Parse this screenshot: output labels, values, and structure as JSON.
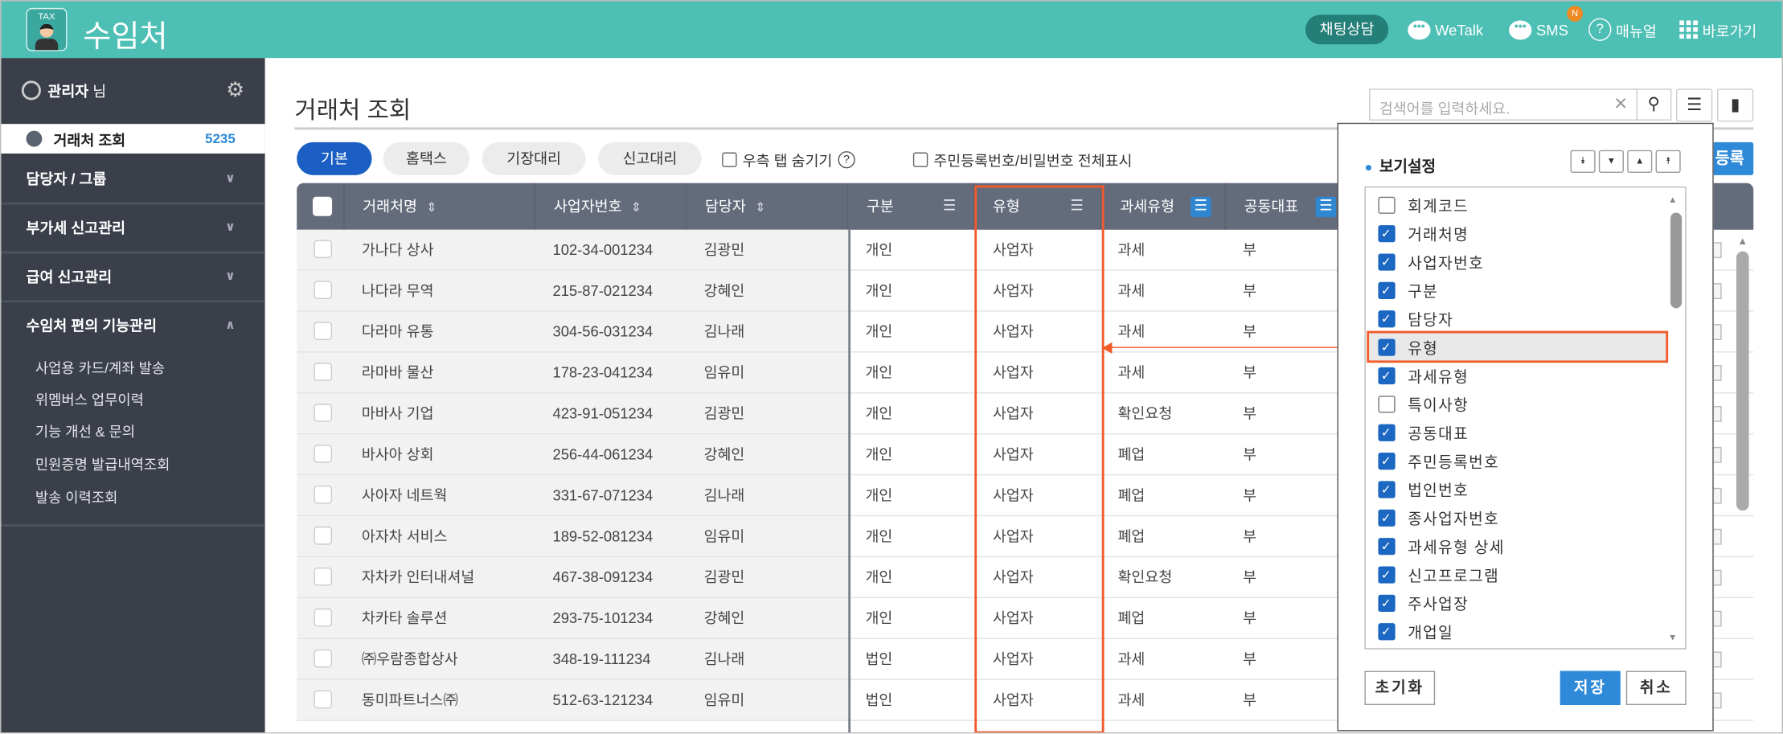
{
  "header": {
    "app_title": "수임처",
    "logo_text": "TAX",
    "chat_label": "채팅상담",
    "wetalk_label": "WeTalk",
    "sms_label": "SMS",
    "sms_badge": "N",
    "manual_label": "매뉴얼",
    "shortcut_label": "바로가기"
  },
  "sidebar": {
    "user_name": "관리자",
    "user_suffix": "님",
    "active_item": {
      "label": "거래처 조회",
      "count": "5235"
    },
    "groups": [
      {
        "label": "담당자 / 그룹"
      },
      {
        "label": "부가세 신고관리"
      },
      {
        "label": "급여 신고관리"
      },
      {
        "label": "수임처 편의 기능관리"
      }
    ],
    "sub_items": [
      "사업용 카드/계좌 발송",
      "위멤버스 업무이력",
      "기능 개선 & 문의",
      "민원증명 발급내역조회",
      "발송 이력조회"
    ]
  },
  "main": {
    "title": "거래처 조회",
    "tabs": [
      "기본",
      "홈택스",
      "기장대리",
      "신고대리"
    ],
    "hide_right_tab_label": "우측 탭 숨기기",
    "show_full_id_label": "주민등록번호/비밀번호 전체표시",
    "search_placeholder": "검색어를 입력하세요.",
    "register_label": "등록"
  },
  "table": {
    "columns": [
      "거래처명",
      "사업자번호",
      "담당자",
      "구분",
      "유형",
      "과세유형",
      "공동대표"
    ],
    "rows": [
      [
        "가나다 상사",
        "102-34-001234",
        "김광민",
        "개인",
        "사업자",
        "과세",
        "부"
      ],
      [
        "나다라 무역",
        "215-87-021234",
        "강혜인",
        "개인",
        "사업자",
        "과세",
        "부"
      ],
      [
        "다라마 유통",
        "304-56-031234",
        "김나래",
        "개인",
        "사업자",
        "과세",
        "부"
      ],
      [
        "라마바 물산",
        "178-23-041234",
        "임유미",
        "개인",
        "사업자",
        "과세",
        "부"
      ],
      [
        "마바사 기업",
        "423-91-051234",
        "김광민",
        "개인",
        "사업자",
        "확인요청",
        "부"
      ],
      [
        "바사아 상회",
        "256-44-061234",
        "강혜인",
        "개인",
        "사업자",
        "폐업",
        "부"
      ],
      [
        "사아자 네트웍",
        "331-67-071234",
        "김나래",
        "개인",
        "사업자",
        "폐업",
        "부"
      ],
      [
        "아자차 서비스",
        "189-52-081234",
        "임유미",
        "개인",
        "사업자",
        "폐업",
        "부"
      ],
      [
        "자차카 인터내셔널",
        "467-38-091234",
        "김광민",
        "개인",
        "사업자",
        "확인요청",
        "부"
      ],
      [
        "차카타 솔루션",
        "293-75-101234",
        "강혜인",
        "개인",
        "사업자",
        "폐업",
        "부"
      ],
      [
        "㈜우람종합상사",
        "348-19-111234",
        "김나래",
        "법인",
        "사업자",
        "과세",
        "부"
      ],
      [
        "동미파트너스㈜",
        "512-63-121234",
        "임유미",
        "법인",
        "사업자",
        "과세",
        "부"
      ]
    ]
  },
  "view_settings": {
    "title": "보기설정",
    "items": [
      {
        "label": "회계코드",
        "checked": false
      },
      {
        "label": "거래처명",
        "checked": true
      },
      {
        "label": "사업자번호",
        "checked": true
      },
      {
        "label": "구분",
        "checked": true
      },
      {
        "label": "담당자",
        "checked": true
      },
      {
        "label": "유형",
        "checked": true,
        "highlighted": true
      },
      {
        "label": "과세유형",
        "checked": true
      },
      {
        "label": "특이사항",
        "checked": false
      },
      {
        "label": "공동대표",
        "checked": true
      },
      {
        "label": "주민등록번호",
        "checked": true
      },
      {
        "label": "법인번호",
        "checked": true
      },
      {
        "label": "종사업자번호",
        "checked": true
      },
      {
        "label": "과세유형 상세",
        "checked": true
      },
      {
        "label": "신고프로그램",
        "checked": true
      },
      {
        "label": "주사업장",
        "checked": true
      },
      {
        "label": "개업일",
        "checked": true
      }
    ],
    "reset_label": "초기화",
    "save_label": "저장",
    "cancel_label": "취소"
  },
  "colors": {
    "header": "#4dbfb5",
    "sidebar": "#3a3f4a",
    "accent": "#2e8ad8",
    "highlight": "#f25a2a"
  }
}
